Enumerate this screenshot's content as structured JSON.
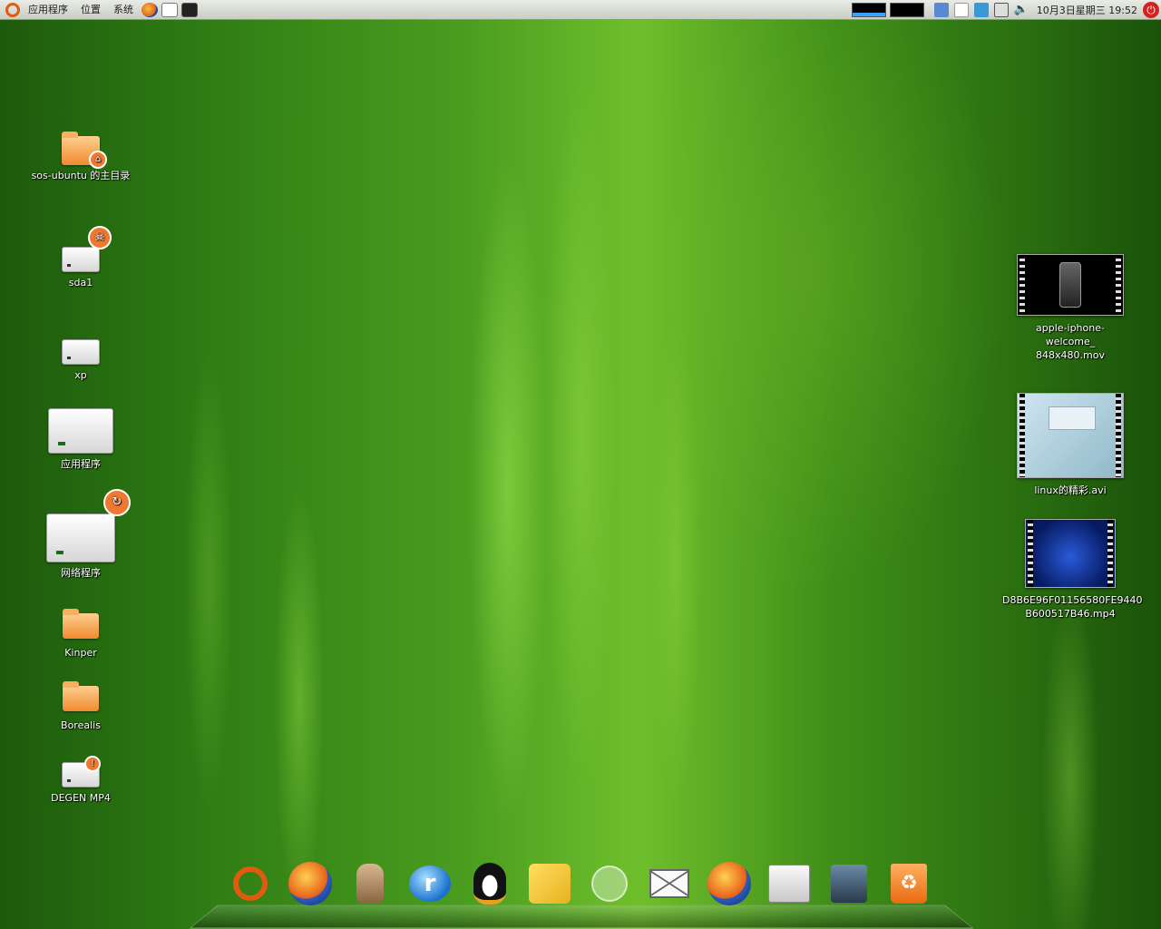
{
  "topbar": {
    "menus": [
      "应用程序",
      "位置",
      "系统"
    ],
    "clock": "10月3日星期三 19:52"
  },
  "desktop_icons_left": [
    {
      "label": "sos-ubuntu 的主目录",
      "icon": "home-folder-icon"
    },
    {
      "label": "sda1",
      "icon": "drive-icon"
    },
    {
      "label": "xp",
      "icon": "drive-icon"
    },
    {
      "label": "应用程序",
      "icon": "drive-icon"
    },
    {
      "label": "网络程序",
      "icon": "drive-icon"
    },
    {
      "label": "Kinper",
      "icon": "folder-icon"
    },
    {
      "label": "Borealis",
      "icon": "folder-icon"
    },
    {
      "label": "DEGEN MP4",
      "icon": "drive-icon"
    }
  ],
  "desktop_icons_right": [
    {
      "label_line1": "apple-iphone-welcome_",
      "label_line2": "848x480.mov",
      "icon": "video-thumbnail-icon"
    },
    {
      "label_line1": "linux的精彩.avi",
      "label_line2": "",
      "icon": "video-thumbnail-icon"
    },
    {
      "label_line1": "D8B6E96F01156580FE9440",
      "label_line2": "B600517B46.mp4",
      "icon": "video-thumbnail-icon"
    }
  ],
  "dock": [
    {
      "name": "ubuntu-dock-icon"
    },
    {
      "name": "firefox-dock-icon"
    },
    {
      "name": "emule-dock-icon"
    },
    {
      "name": "realplayer-dock-icon"
    },
    {
      "name": "qq-penguin-dock-icon"
    },
    {
      "name": "tools-dock-icon"
    },
    {
      "name": "gimp-dock-icon"
    },
    {
      "name": "mail-dock-icon"
    },
    {
      "name": "firefox-dock-icon"
    },
    {
      "name": "file-cabinet-dock-icon"
    },
    {
      "name": "transformers-dock-icon"
    },
    {
      "name": "trash-dock-icon"
    }
  ],
  "colors": {
    "panel": "#d8dcd3",
    "folder": "#f08a30",
    "accent": "#e05a10",
    "grass": "#4a9d1f"
  }
}
